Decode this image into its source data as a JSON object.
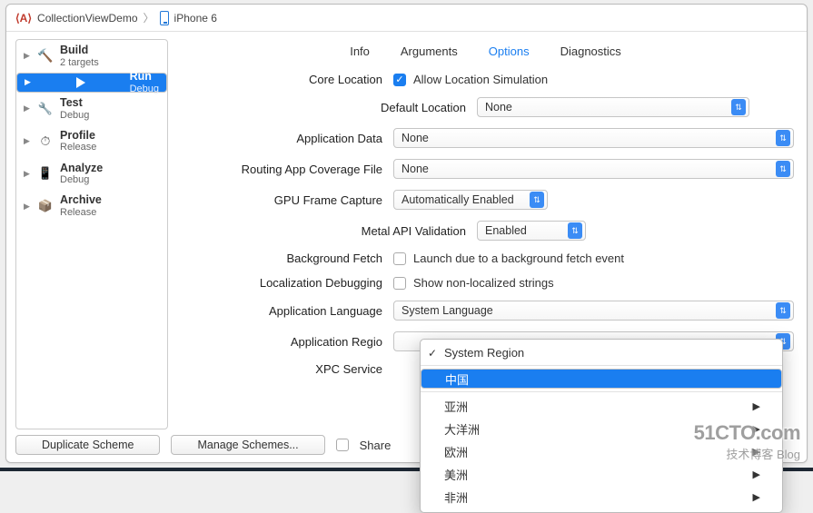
{
  "breadcrumbs": {
    "project": "CollectionViewDemo",
    "device": "iPhone 6"
  },
  "sidebar": {
    "items": [
      {
        "name": "Build",
        "sub": "2 targets"
      },
      {
        "name": "Run",
        "sub": "Debug"
      },
      {
        "name": "Test",
        "sub": "Debug"
      },
      {
        "name": "Profile",
        "sub": "Release"
      },
      {
        "name": "Analyze",
        "sub": "Debug"
      },
      {
        "name": "Archive",
        "sub": "Release"
      }
    ]
  },
  "tabs": {
    "info": "Info",
    "arguments": "Arguments",
    "options": "Options",
    "diagnostics": "Diagnostics"
  },
  "form": {
    "core_location_lbl": "Core Location",
    "allow_loc_sim": "Allow Location Simulation",
    "default_location_lbl": "Default Location",
    "default_location_val": "None",
    "app_data_lbl": "Application Data",
    "app_data_val": "None",
    "routing_lbl": "Routing App Coverage File",
    "routing_val": "None",
    "gpu_lbl": "GPU Frame Capture",
    "gpu_val": "Automatically Enabled",
    "metal_lbl": "Metal API Validation",
    "metal_val": "Enabled",
    "bg_fetch_lbl": "Background Fetch",
    "bg_fetch_txt": "Launch due to a background fetch event",
    "loc_debug_lbl": "Localization Debugging",
    "loc_debug_txt": "Show non-localized strings",
    "app_lang_lbl": "Application Language",
    "app_lang_val": "System Language",
    "app_region_lbl": "Application Regio",
    "xpc_lbl": "XPC Service"
  },
  "dropdown": {
    "system_region": "System Region",
    "china": "中国",
    "asia": "亚洲",
    "oceania": "大洋洲",
    "europe": "欧洲",
    "americas": "美洲",
    "africa": "非洲"
  },
  "footer": {
    "duplicate": "Duplicate Scheme",
    "manage": "Manage Schemes...",
    "share": "Share"
  },
  "watermark": {
    "big": "51CTO.com",
    "sm": "技术博客    Blog"
  }
}
